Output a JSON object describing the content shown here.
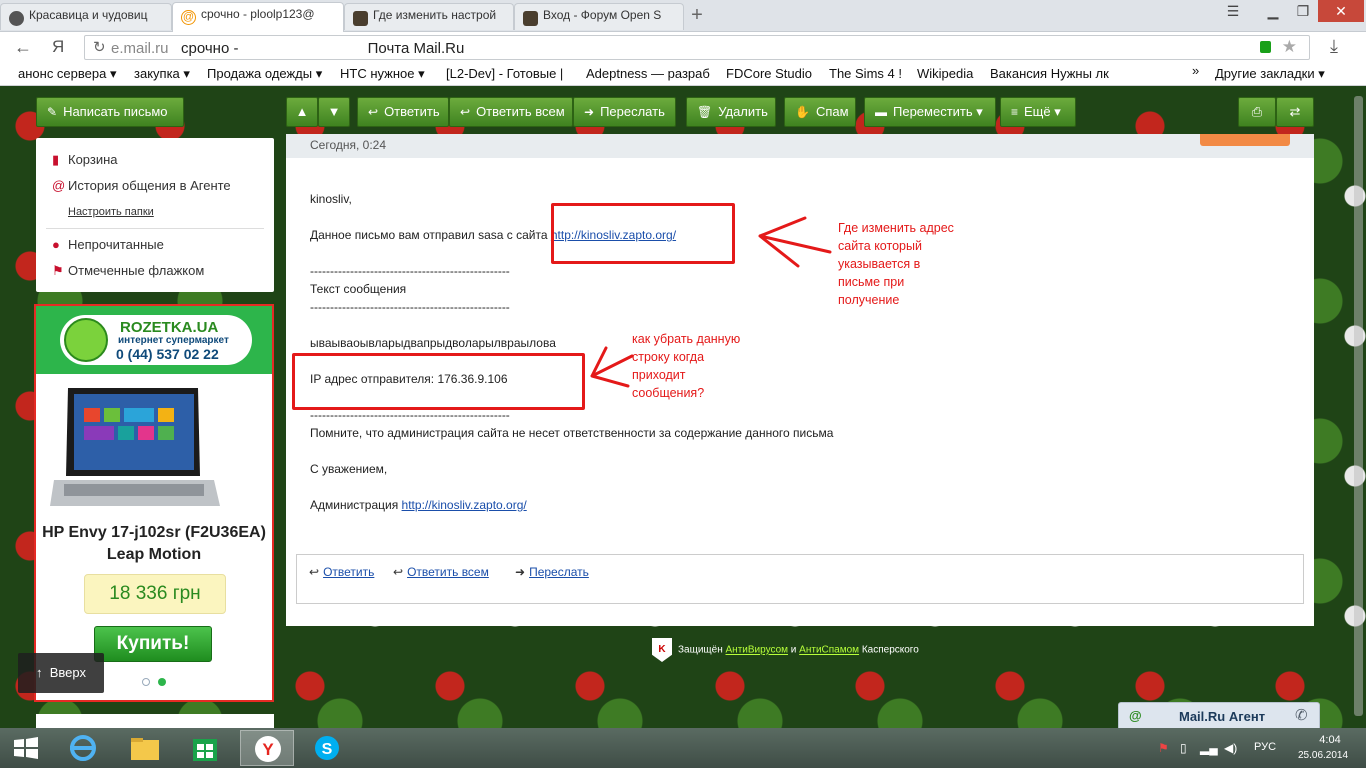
{
  "browser": {
    "tabs": [
      {
        "title": "Красавица и чудовиц",
        "icon": "girl-avatar-icon"
      },
      {
        "title": "срочно - ploolp123@",
        "icon": "mailru-at-icon"
      },
      {
        "title": "Где изменить настрой",
        "icon": "forum-icon"
      },
      {
        "title": "Вход - Форум Open S",
        "icon": "forum-icon"
      }
    ],
    "url_domain": "e.mail.ru",
    "url_title": "срочно -                               Почта Mail.Ru",
    "bookmarks": [
      "анонс сервера ▾",
      "закупка ▾",
      "Продажа одежды ▾",
      "HTC нужное ▾",
      "[L2-Dev] - Готовые |",
      "Adeptness — разраб",
      "FDCore Studio",
      "The Sims 4 !",
      "Wikipedia",
      "Вакансия Нужны лк",
      "»",
      "Другие закладки ▾"
    ]
  },
  "toolbar": {
    "compose": "Написать письмо",
    "reply": "Ответить",
    "reply_all": "Ответить всем",
    "forward": "Переслать",
    "delete": "Удалить",
    "spam": "Спам",
    "move": "Переместить",
    "more": "Ещё"
  },
  "sidebar": {
    "items": [
      "Корзина",
      "История общения в Агенте",
      "Непрочитанные",
      "Отмеченные флажком"
    ],
    "settings": "Настроить папки"
  },
  "ad": {
    "brand": "ROZETKA.UA",
    "subtitle": "интернет супермаркет",
    "phone": "0 (44) 537 02 22",
    "product": "HP Envy 17-j102sr (F2U36EA) Leap Motion",
    "price": "18 336 грн",
    "buy": "Купить!"
  },
  "scroll_top": "Вверх",
  "letter": {
    "date": "Сегодня, 0:24",
    "greeting": "kinosliv,",
    "line1_text": "Данное письмо вам отправил sasa с сайта ",
    "site_link": "http://kinosliv.zapto.org/",
    "separator": "--------------------------------------------------",
    "msg_header": "Текст сообщения",
    "body": "ываываоывларыдвапрыдволарылврaылова",
    "ip_line": "IP адрес отправителя: 176.36.9.106",
    "disclaimer": "Помните, что администрация сайта не несет ответственности за содержание данного письма",
    "regards": "С уважением,",
    "admin_text": "Администрация ",
    "reply": "Ответить",
    "reply_all": "Ответить всем",
    "forward": "Переслать"
  },
  "annotations": {
    "note1": "Где изменить адрес\nсайта который\nуказывается в\nписьме при\nполучение",
    "note2": "как убрать данную\nстроку когда\nприходит\nсообщения?"
  },
  "footer": {
    "protected": "Защищён ",
    "antivirus": "АнтиВирусом",
    "and": " и ",
    "antispam": "АнтиСпамом",
    "kaspersky": " Касперского"
  },
  "agent": {
    "label": "Mail.Ru Агент"
  },
  "taskbar": {
    "lang": "РУС",
    "time": "4:04",
    "date": "25.06.2014"
  },
  "colors": {
    "accent_green": "#3f8320",
    "annotation_red": "#e41919",
    "link": "#1a4eaa"
  }
}
